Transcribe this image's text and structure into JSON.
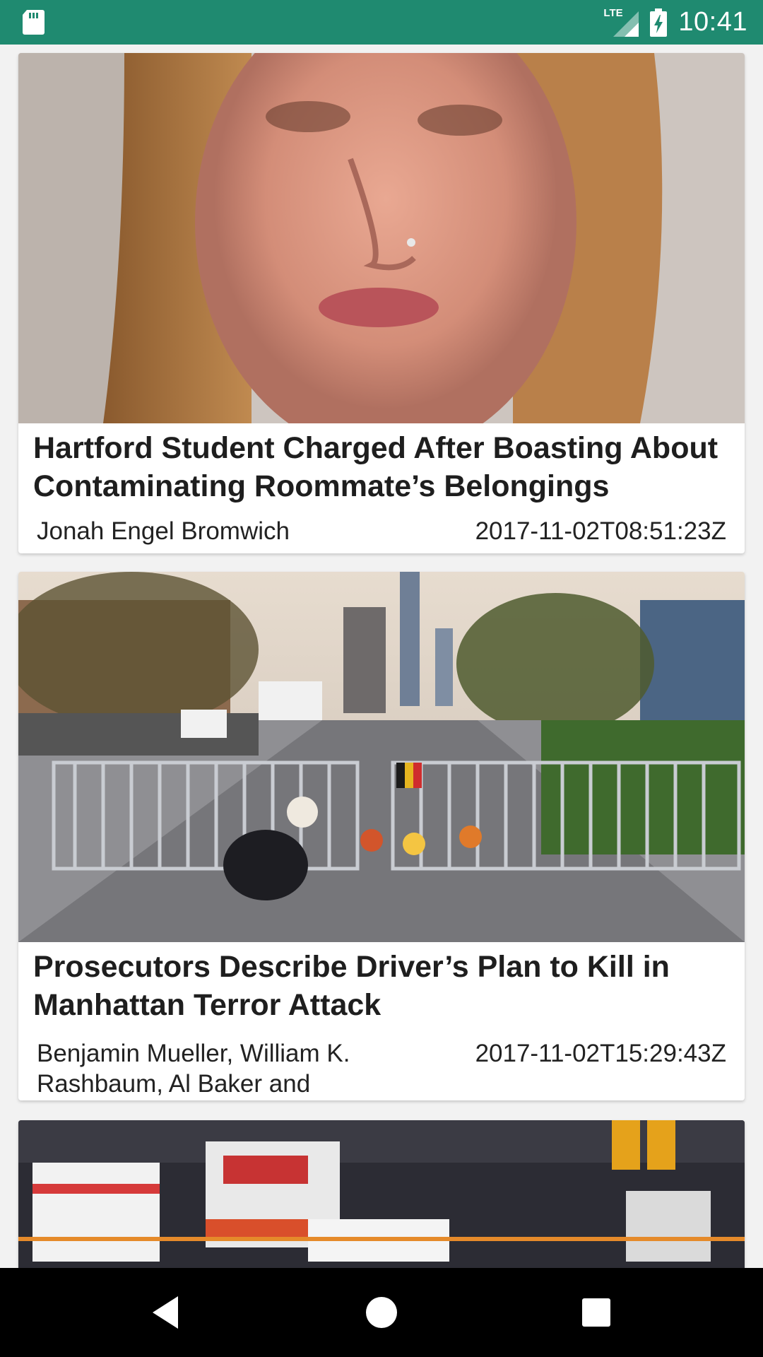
{
  "status_bar": {
    "left_icon": "sd-card-icon",
    "network": "LTE",
    "time": "10:41",
    "color": "#1f8a70"
  },
  "articles": [
    {
      "image_alt": "portrait-photo",
      "title": "Hartford Student Charged After Boasting About Contaminating Roommate’s Belongings",
      "author": "Jonah Engel Bromwich",
      "date": "2017-11-02T08:51:23Z"
    },
    {
      "image_alt": "street-memorial-photo",
      "title": "Prosecutors Describe Driver’s Plan to Kill in Manhattan Terror Attack",
      "author": "Benjamin Mueller, William K. Rashbaum, Al Baker and",
      "date": "2017-11-02T15:29:43Z"
    },
    {
      "image_alt": "emergency-vehicles-photo"
    }
  ],
  "nav_bar": {
    "back": "back-icon",
    "home": "home-icon",
    "recents": "recents-icon"
  }
}
